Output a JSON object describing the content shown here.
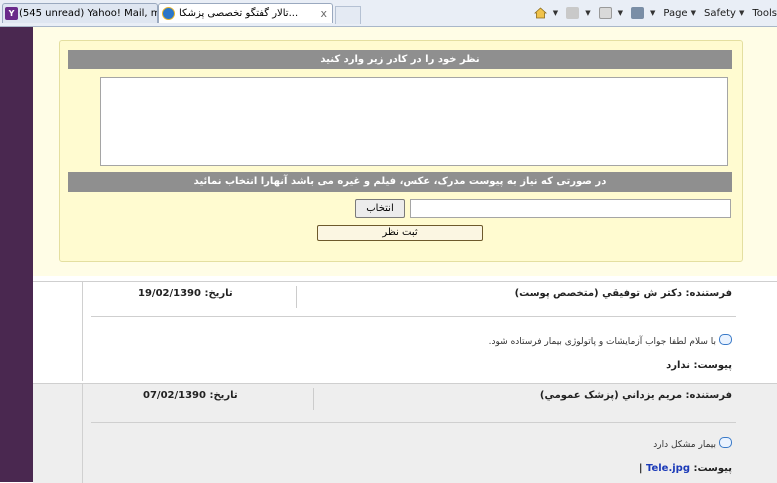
{
  "browser": {
    "tabs": [
      {
        "label": "(545 unread) Yahoo! Mail, m...",
        "icon": "yahoo-icon"
      },
      {
        "label": "...تالار گفتگو تخصصی پزشکا",
        "icon": "ie-icon",
        "close": "x"
      }
    ],
    "toolbar": {
      "page_label": "Page",
      "safety_label": "Safety",
      "tools_label": "Tools"
    }
  },
  "form": {
    "comment_prompt": "نظر خود را در کادر زیر وارد کنید",
    "attach_prompt": "در صورتی که نیاز به پیوست مدرک، عکس، فیلم و غیره می باشد آنهارا انتخاب نمائید",
    "browse_label": "انتخاب",
    "submit_label": "ثبت نظر"
  },
  "posts": [
    {
      "sender": "فرستنده: دکتر ش توفيقي (متخصص پوست)",
      "date_label": "تاریخ: 19/02/1390",
      "message": "با سلام لطفا جواب آزمایشات و پاتولوژی بیمار فرستاده شود.",
      "attachment_label": "پیوست: ندارد"
    },
    {
      "sender": "فرستنده: مريم يزداني (پزشک عمومي)",
      "date_label": "تاریخ: 07/02/1390",
      "message": "بیمار مشکل دارد",
      "attachment_label": "پیوست:",
      "attachment_file": "Tele.jpg",
      "attachment_sep": "|"
    }
  ],
  "colors": {
    "sidebar": "#4a2850",
    "panel": "#fffde6",
    "bar": "#8f8f8f",
    "link": "#1b3ab8"
  }
}
